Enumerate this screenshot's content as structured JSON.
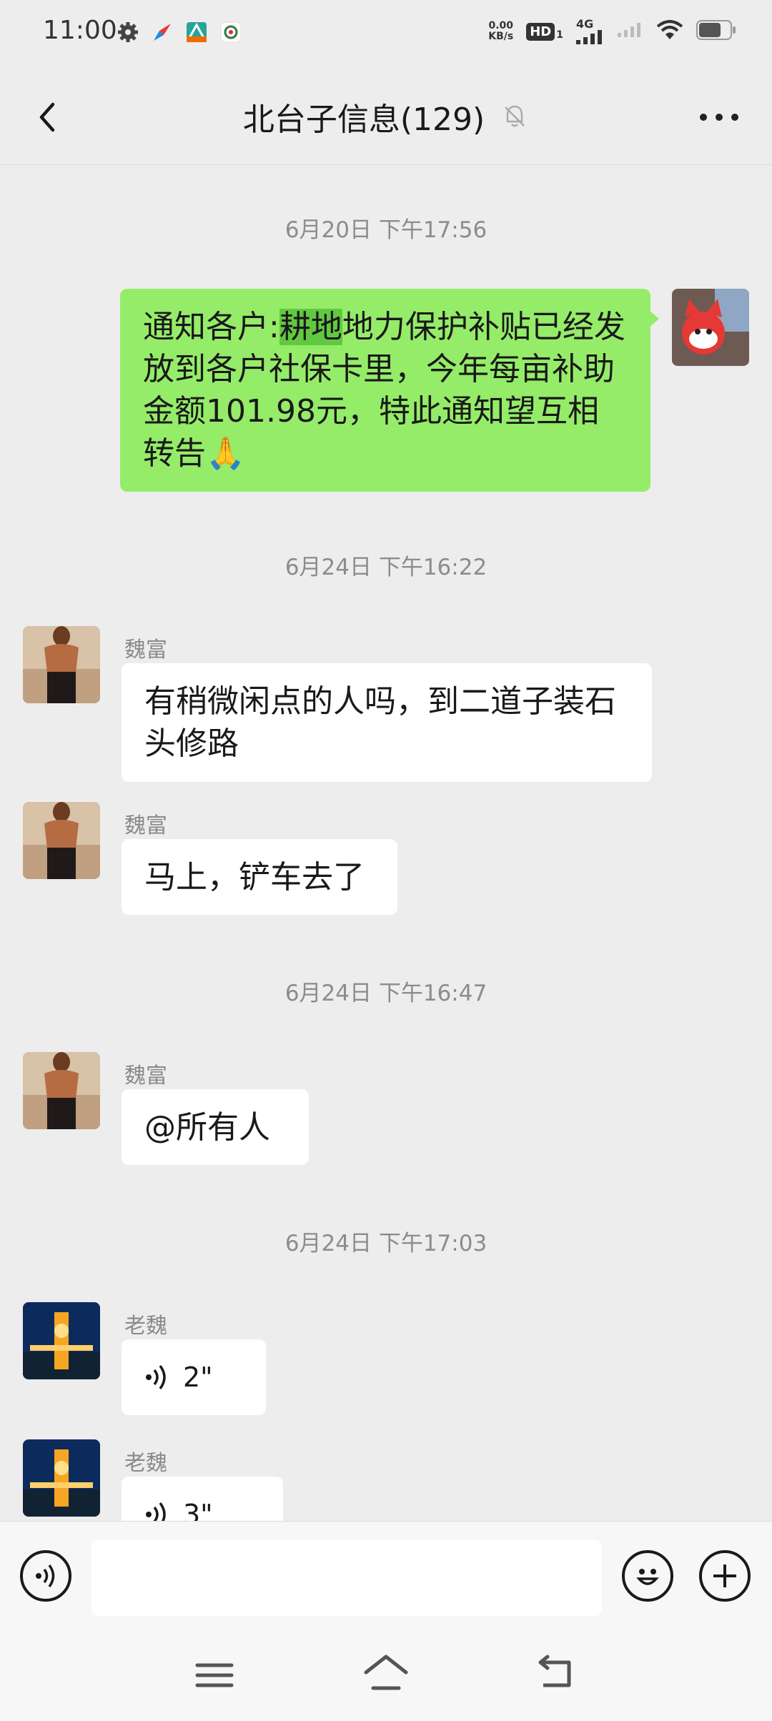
{
  "status": {
    "time": "11:00",
    "net_speed_top": "0.00",
    "net_speed_bottom": "KB/s",
    "hd": "HD",
    "hd_sub": "1",
    "net_type": "4G"
  },
  "header": {
    "title": "北台子信息(129)"
  },
  "messages": [
    {
      "type": "time",
      "text": "6月20日 下午17:56"
    },
    {
      "type": "out",
      "text_prefix": "通知各户:",
      "highlight": "耕地",
      "text_rest": "地力保护补贴已经发放到各户社保卡里，今年每亩补助金额101.98元，特此通知望互相转告",
      "emoji": "🙏"
    },
    {
      "type": "time",
      "text": "6月24日 下午16:22"
    },
    {
      "type": "in",
      "sender": "魏富",
      "text": "有稍微闲点的人吗，到二道子装石头修路"
    },
    {
      "type": "in",
      "sender": "魏富",
      "text": "马上，铲车去了"
    },
    {
      "type": "time",
      "text": "6月24日 下午16:47"
    },
    {
      "type": "in",
      "sender": "魏富",
      "text": "@所有人"
    },
    {
      "type": "time",
      "text": "6月24日 下午17:03"
    },
    {
      "type": "voice",
      "sender": "老魏",
      "duration": "2\""
    },
    {
      "type": "voice",
      "sender": "老魏",
      "duration": "3\""
    }
  ],
  "input": {
    "value": "",
    "placeholder": ""
  }
}
